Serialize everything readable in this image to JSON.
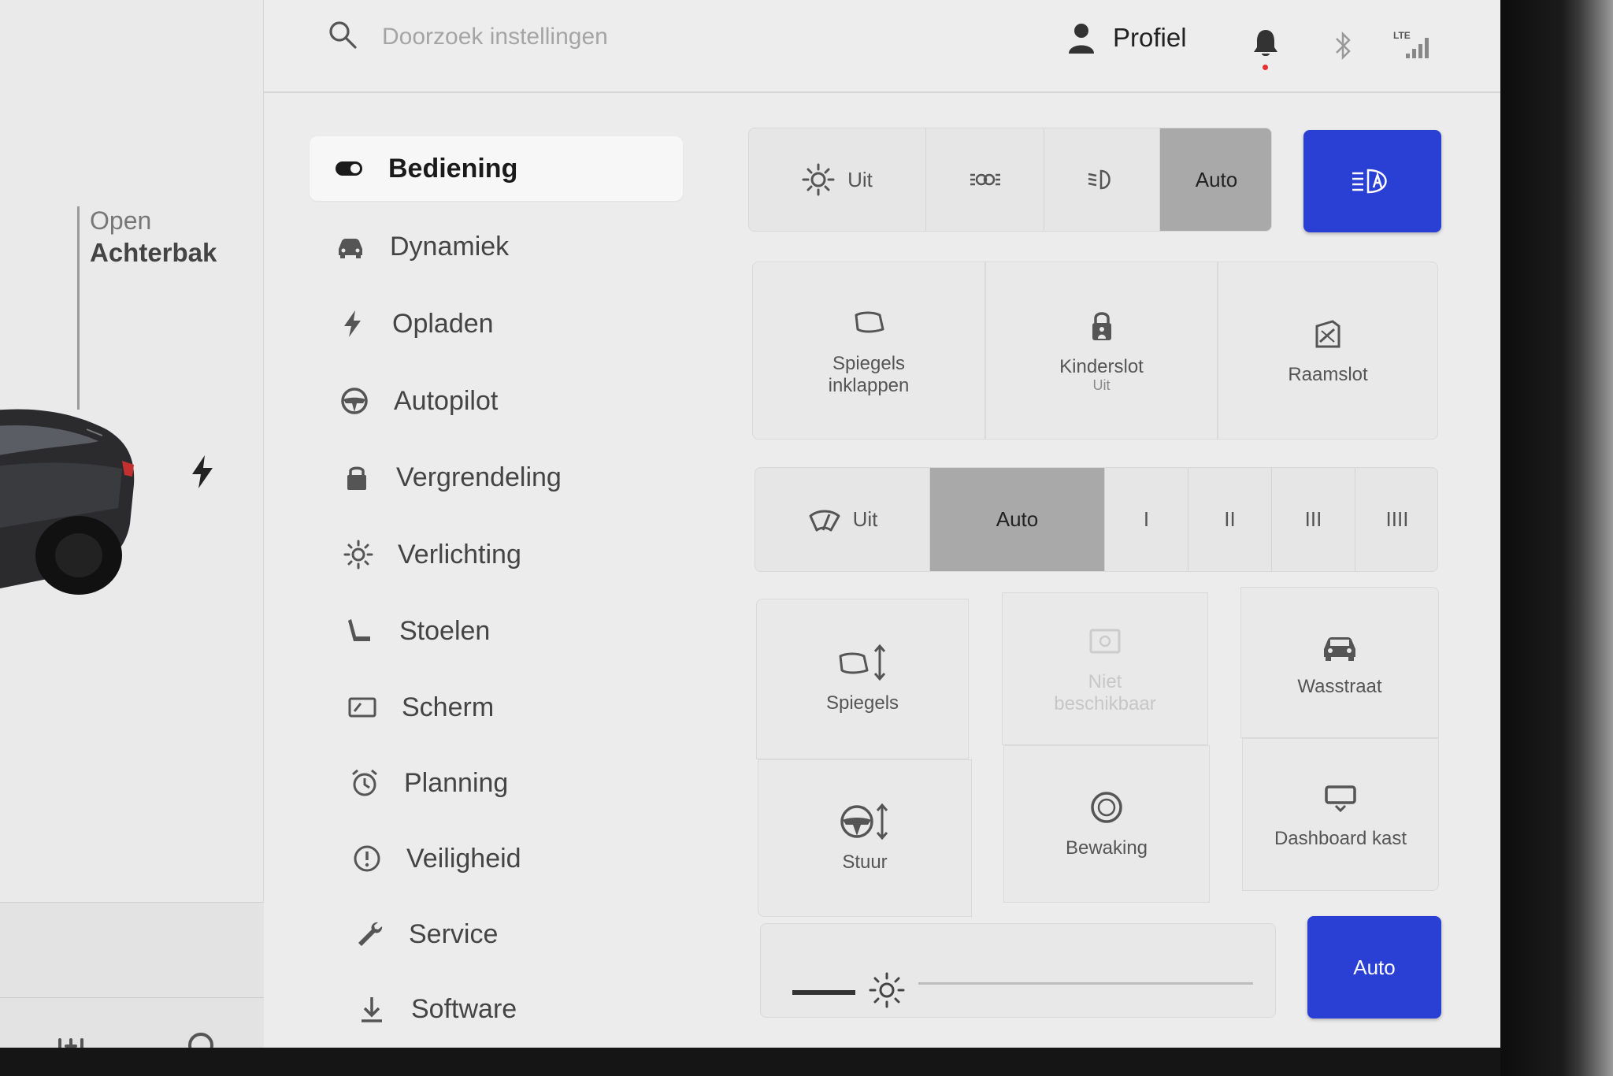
{
  "left_panel": {
    "trunk_line1": "Open",
    "trunk_line2": "Achterbak"
  },
  "header": {
    "search_placeholder": "Doorzoek instellingen",
    "profile_label": "Profiel",
    "lte_label": "LTE"
  },
  "menu": {
    "items": [
      {
        "label": "Bediening",
        "icon": "toggle-icon",
        "active": true
      },
      {
        "label": "Dynamiek",
        "icon": "car-icon"
      },
      {
        "label": "Opladen",
        "icon": "bolt-icon"
      },
      {
        "label": "Autopilot",
        "icon": "steering-wheel-icon"
      },
      {
        "label": "Vergrendeling",
        "icon": "lock-icon"
      },
      {
        "label": "Verlichting",
        "icon": "light-icon"
      },
      {
        "label": "Stoelen",
        "icon": "seat-icon"
      },
      {
        "label": "Scherm",
        "icon": "display-icon"
      },
      {
        "label": "Planning",
        "icon": "alarm-clock-icon"
      },
      {
        "label": "Veiligheid",
        "icon": "alert-circle-icon"
      },
      {
        "label": "Service",
        "icon": "wrench-icon"
      },
      {
        "label": "Software",
        "icon": "download-icon"
      }
    ]
  },
  "lights": {
    "off_label": "Uit",
    "auto_label": "Auto",
    "selected": "Auto"
  },
  "tiles_row1": {
    "mirrors_fold": "Spiegels inklappen",
    "child_lock": "Kinderslot",
    "child_lock_state": "Uit",
    "window_lock": "Raamslot"
  },
  "wipers": {
    "off_label": "Uit",
    "auto_label": "Auto",
    "speeds": [
      "I",
      "II",
      "III",
      "IIII"
    ],
    "selected": "Auto"
  },
  "tiles_grid": {
    "mirrors": "Spiegels",
    "unavailable": "Niet beschikbaar",
    "car_wash": "Wasstraat",
    "steering": "Stuur",
    "sentry": "Bewaking",
    "glovebox": "Dashboard kast"
  },
  "brightness": {
    "auto_label": "Auto"
  },
  "colors": {
    "accent_blue": "#2a3fd4",
    "selected_gray": "#a9a9a9",
    "notification_red": "#e53030"
  }
}
